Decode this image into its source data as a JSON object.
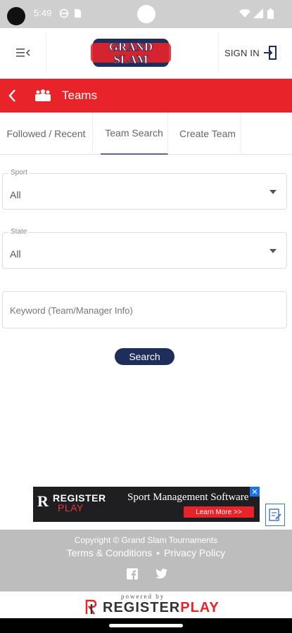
{
  "status_bar": {
    "time": "5:49"
  },
  "header": {
    "logo_text_top": "GRAND",
    "logo_text_bottom": "SLAM",
    "signin_label": "SIGN IN"
  },
  "section": {
    "title": "Teams"
  },
  "tabs": [
    {
      "label": "Followed / Recent",
      "active": false
    },
    {
      "label": "Team Search",
      "active": true
    },
    {
      "label": "Create Team",
      "active": false
    }
  ],
  "form": {
    "sport": {
      "label": "Sport",
      "value": "All"
    },
    "state": {
      "label": "State",
      "value": "All"
    },
    "keyword": {
      "placeholder": "Keyword (Team/Manager Info)",
      "value": ""
    },
    "search_label": "Search"
  },
  "ad": {
    "brand_top": "REGISTER",
    "brand_bottom": "PLAY",
    "headline": "Sport Management Software",
    "cta": "Learn More >>"
  },
  "footer": {
    "copyright": "Copyright © Grand Slam Tournaments",
    "links": [
      "Terms & Conditions",
      "Privacy Policy"
    ],
    "separator": "•",
    "social": [
      "facebook-icon",
      "twitter-icon"
    ],
    "powered_by": "powered by",
    "powered_brand_a": "REGISTER",
    "powered_brand_b": "PLAY"
  },
  "colors": {
    "accent_red": "#e8232a",
    "navy": "#1f2d5a",
    "footer_gray": "#bdbdbd"
  }
}
